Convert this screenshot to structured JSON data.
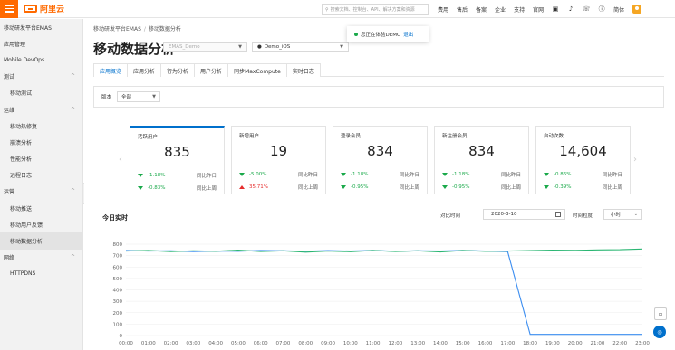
{
  "topbar": {
    "brand": "阿里云",
    "search_placeholder": "搜索文档、控制台、API、解决方案和资源",
    "nav": [
      "费用",
      "售后",
      "备案",
      "企业",
      "支持",
      "官网"
    ],
    "icons": [
      "screen-icon",
      "bell-icon",
      "cart-icon",
      "help-icon"
    ],
    "lang": "简体"
  },
  "sidebar": {
    "items": [
      {
        "label": "移动研发平台EMAS",
        "sub": false
      },
      {
        "label": "应用管理",
        "sub": false
      },
      {
        "label": "Mobile DevOps",
        "sub": false
      },
      {
        "label": "测试",
        "sub": false,
        "chev": "^"
      },
      {
        "label": "移动测试",
        "sub": true
      },
      {
        "label": "运维",
        "sub": false,
        "chev": "^"
      },
      {
        "label": "移动热修复",
        "sub": true
      },
      {
        "label": "崩溃分析",
        "sub": true
      },
      {
        "label": "性能分析",
        "sub": true
      },
      {
        "label": "远程日志",
        "sub": true
      },
      {
        "label": "运营",
        "sub": false,
        "chev": "^"
      },
      {
        "label": "移动推送",
        "sub": true
      },
      {
        "label": "移动用户反馈",
        "sub": true
      },
      {
        "label": "移动数据分析",
        "sub": true,
        "active": true
      },
      {
        "label": "网络",
        "sub": false,
        "chev": "^"
      },
      {
        "label": "HTTPDNS",
        "sub": true
      }
    ]
  },
  "breadcrumb": {
    "root": "移动研发平台EMAS",
    "sep": "/",
    "current": "移动数据分析"
  },
  "page_title": "移动数据分析",
  "app_select": "EMAS_Demo",
  "os_select": "Demo_iOS",
  "toast": {
    "text": "您正在体验DEMO",
    "link": "退出"
  },
  "tabs": [
    "应用概览",
    "应用分析",
    "行为分析",
    "用户分析",
    "同步MaxCompute",
    "实时日志"
  ],
  "filter": {
    "label": "版本",
    "value": "全部"
  },
  "metrics": [
    {
      "name": "活跃用户",
      "value": "835",
      "r1_pct": "-1.18%",
      "r1_dir": "down",
      "r1_label": "同比昨日",
      "r2_pct": "-0.83%",
      "r2_dir": "down",
      "r2_label": "同比上周"
    },
    {
      "name": "新增用户",
      "value": "19",
      "r1_pct": "-5.00%",
      "r1_dir": "down",
      "r1_label": "同比昨日",
      "r2_pct": "35.71%",
      "r2_dir": "up",
      "r2_label": "同比上周"
    },
    {
      "name": "登录会员",
      "value": "834",
      "r1_pct": "-1.18%",
      "r1_dir": "down",
      "r1_label": "同比昨日",
      "r2_pct": "-0.95%",
      "r2_dir": "down",
      "r2_label": "同比上周"
    },
    {
      "name": "新注册会员",
      "value": "834",
      "r1_pct": "-1.18%",
      "r1_dir": "down",
      "r1_label": "同比昨日",
      "r2_pct": "-0.95%",
      "r2_dir": "down",
      "r2_label": "同比上周"
    },
    {
      "name": "启动次数",
      "value": "14,604",
      "r1_pct": "-0.86%",
      "r1_dir": "down",
      "r1_label": "同比昨日",
      "r2_pct": "-0.39%",
      "r2_dir": "down",
      "r2_label": "同比上周"
    }
  ],
  "realtime": {
    "title": "今日实时",
    "compare_label": "对比时间",
    "compare_date": "2020-3-10",
    "granularity_label": "时间粒度",
    "granularity": "小时"
  },
  "colors": {
    "accent": "#0070cc",
    "brand": "#ff6a00",
    "green": "#1aa94a",
    "red": "#e62e2e",
    "series_today": "#3d8ef0",
    "series_compare": "#2bb673"
  },
  "chart_data": {
    "type": "line",
    "x": [
      "00:00",
      "01:00",
      "02:00",
      "03:00",
      "04:00",
      "05:00",
      "06:00",
      "07:00",
      "08:00",
      "09:00",
      "10:00",
      "11:00",
      "12:00",
      "13:00",
      "14:00",
      "15:00",
      "16:00",
      "17:00",
      "18:00",
      "19:00",
      "20:00",
      "21:00",
      "22:00",
      "23:00"
    ],
    "ylim": [
      0,
      800
    ],
    "yticks": [
      0,
      100,
      200,
      300,
      400,
      500,
      600,
      700,
      800
    ],
    "series": [
      {
        "values": [
          745,
          740,
          742,
          735,
          740,
          738,
          745,
          742,
          738,
          744,
          740,
          745,
          738,
          742,
          740,
          745,
          740,
          735,
          10,
          10,
          10,
          10,
          10,
          10
        ]
      },
      {
        "values": [
          740,
          745,
          735,
          742,
          738,
          748,
          736,
          742,
          730,
          740,
          734,
          745,
          736,
          742,
          732,
          745,
          738,
          740,
          744,
          748,
          746,
          750,
          752,
          758
        ]
      }
    ],
    "grid": true
  }
}
